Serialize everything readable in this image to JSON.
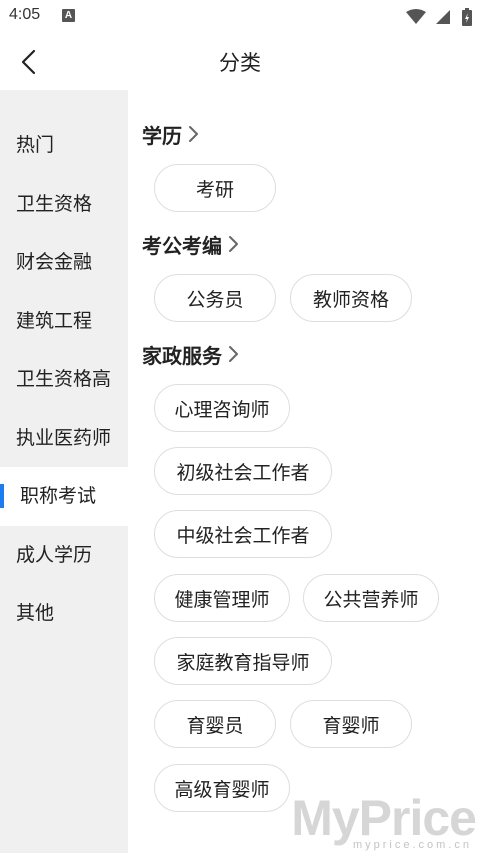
{
  "status_bar": {
    "time": "4:05",
    "notification_icon_letter": "A"
  },
  "header": {
    "title": "分类"
  },
  "sidebar": {
    "items": [
      {
        "label": "热门",
        "active": false
      },
      {
        "label": "卫生资格",
        "active": false
      },
      {
        "label": "财会金融",
        "active": false
      },
      {
        "label": "建筑工程",
        "active": false
      },
      {
        "label": "卫生资格高",
        "active": false
      },
      {
        "label": "执业医药师",
        "active": false
      },
      {
        "label": "职称考试",
        "active": true
      },
      {
        "label": "成人学历",
        "active": false
      },
      {
        "label": "其他",
        "active": false
      }
    ],
    "accent_color": "#1e7bf0"
  },
  "sections": [
    {
      "title": "学历",
      "chips": [
        "考研"
      ]
    },
    {
      "title": "考公考编",
      "chips": [
        "公务员",
        "教师资格"
      ]
    },
    {
      "title": "家政服务",
      "chips": [
        "心理咨询师",
        "初级社会工作者",
        "中级社会工作者",
        "健康管理师",
        "公共营养师",
        "家庭教育指导师",
        "育婴员",
        "育婴师",
        "高级育婴师"
      ]
    }
  ],
  "watermark": {
    "logo": "MyPrice",
    "url": "myprice.com.cn"
  }
}
